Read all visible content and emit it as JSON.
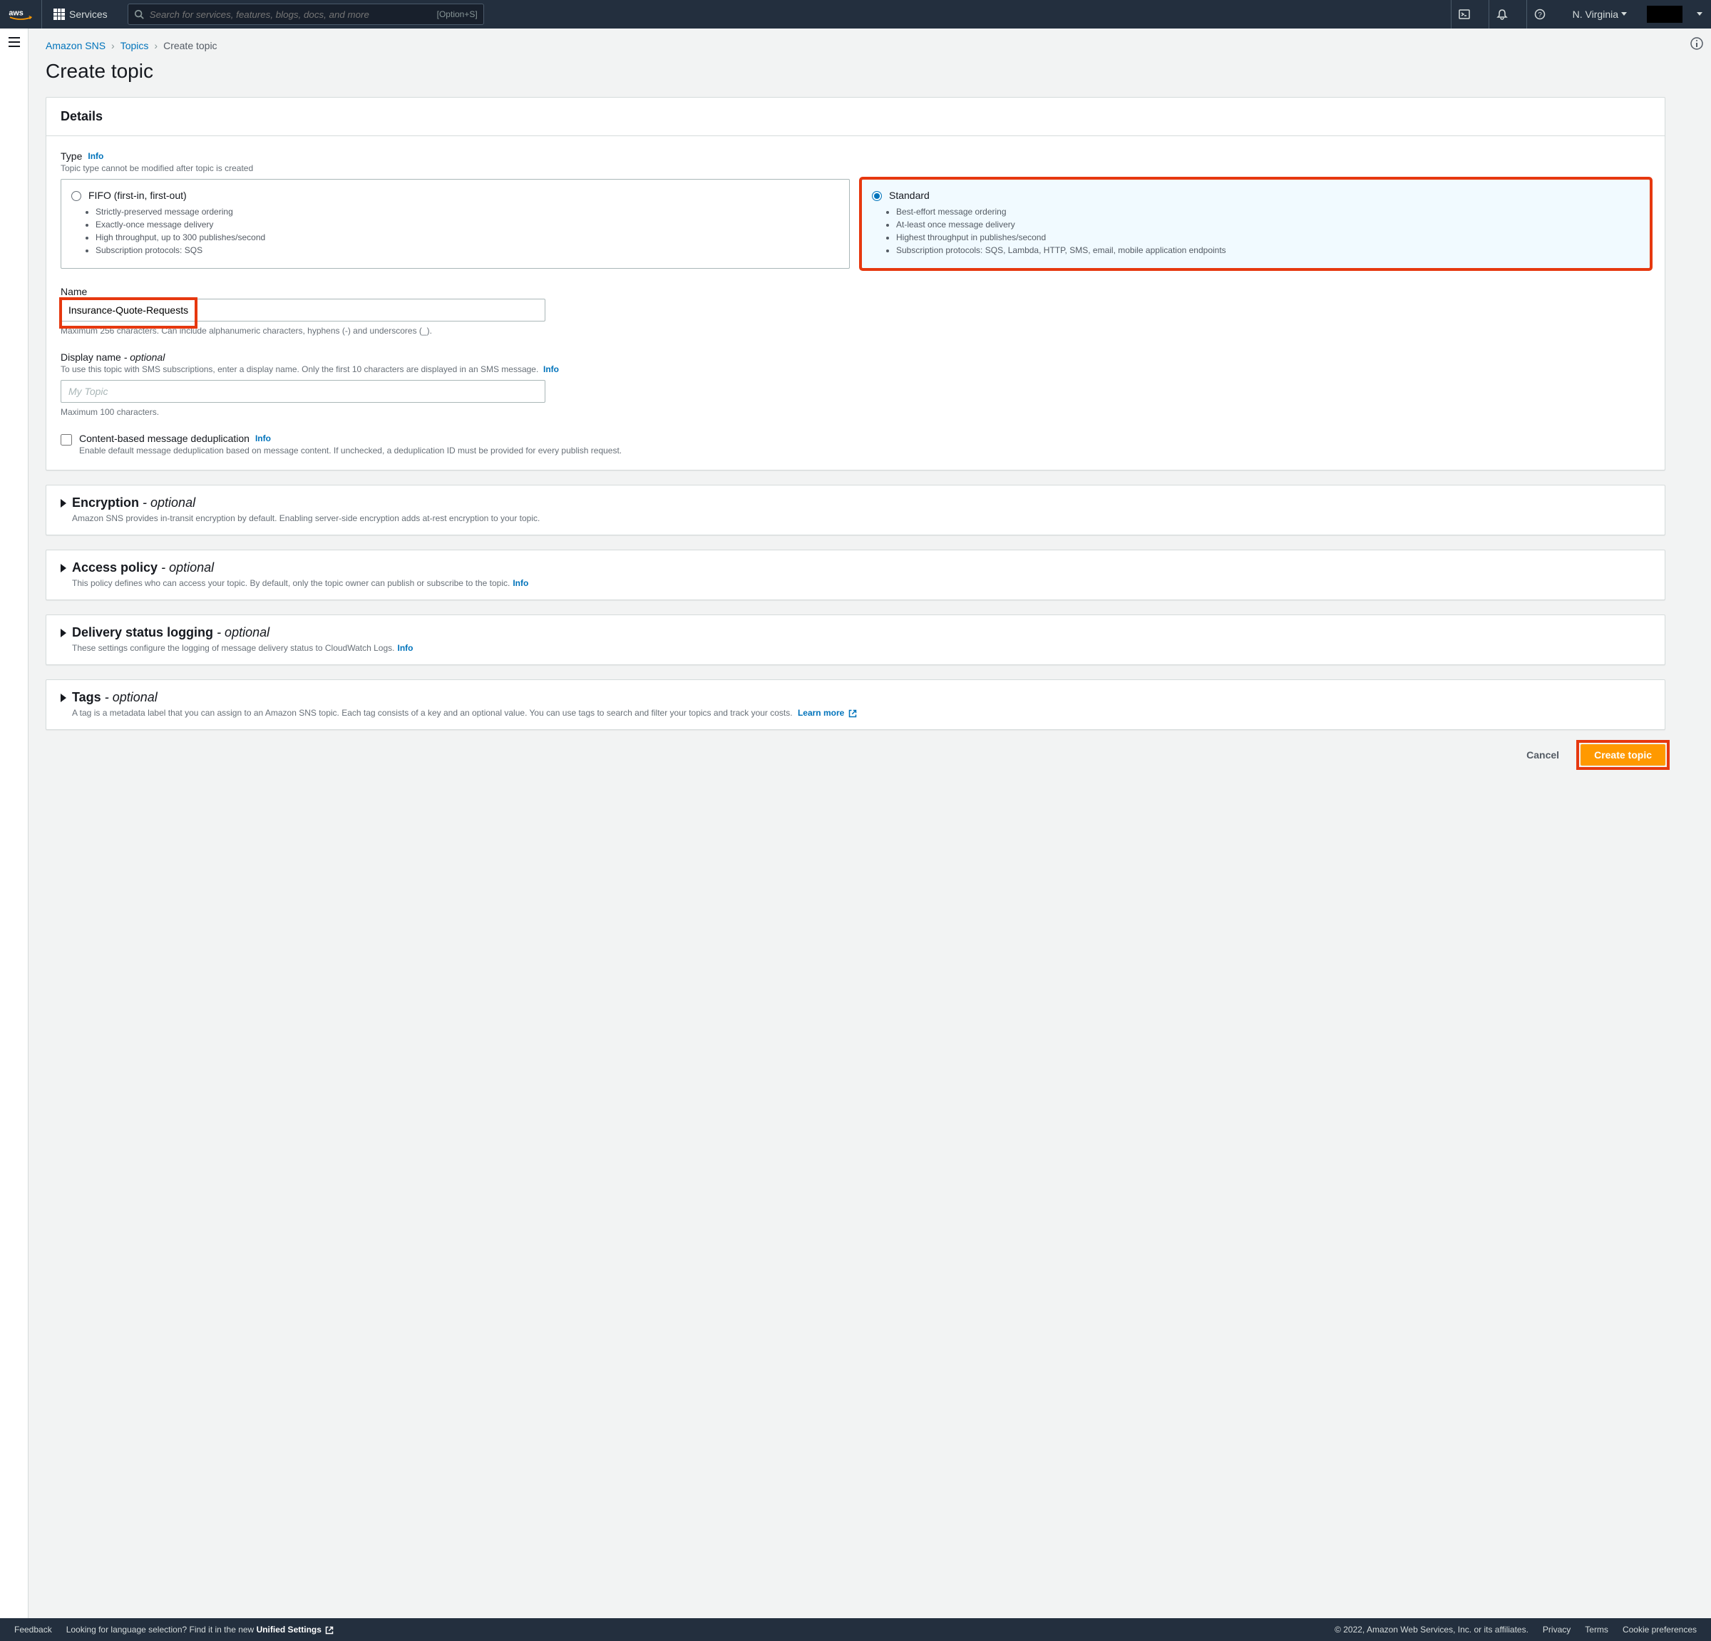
{
  "topnav": {
    "services": "Services",
    "search_placeholder": "Search for services, features, blogs, docs, and more",
    "shortcut": "[Option+S]",
    "region": "N. Virginia"
  },
  "breadcrumb": {
    "items": [
      "Amazon SNS",
      "Topics",
      "Create topic"
    ]
  },
  "page_title": "Create topic",
  "details": {
    "heading": "Details",
    "type": {
      "label": "Type",
      "info": "Info",
      "hint": "Topic type cannot be modified after topic is created",
      "fifo": {
        "title": "FIFO (first-in, first-out)",
        "bullets": [
          "Strictly-preserved message ordering",
          "Exactly-once message delivery",
          "High throughput, up to 300 publishes/second",
          "Subscription protocols: SQS"
        ]
      },
      "standard": {
        "title": "Standard",
        "bullets": [
          "Best-effort message ordering",
          "At-least once message delivery",
          "Highest throughput in publishes/second",
          "Subscription protocols: SQS, Lambda, HTTP, SMS, email, mobile application endpoints"
        ]
      }
    },
    "name": {
      "label": "Name",
      "value": "Insurance-Quote-Requests",
      "hint": "Maximum 256 characters. Can include alphanumeric characters, hyphens (-) and underscores (_)."
    },
    "display_name": {
      "label": "Display name",
      "optional": "- optional",
      "hint": "To use this topic with SMS subscriptions, enter a display name. Only the first 10 characters are displayed in an SMS message.",
      "info": "Info",
      "placeholder": "My Topic",
      "post_hint": "Maximum 100 characters."
    },
    "dedup": {
      "label": "Content-based message deduplication",
      "info": "Info",
      "desc": "Enable default message deduplication based on message content. If unchecked, a deduplication ID must be provided for every publish request."
    }
  },
  "encryption": {
    "title": "Encryption",
    "optional": "- optional",
    "desc": "Amazon SNS provides in-transit encryption by default. Enabling server-side encryption adds at-rest encryption to your topic."
  },
  "access_policy": {
    "title": "Access policy",
    "optional": "- optional",
    "desc": "This policy defines who can access your topic. By default, only the topic owner can publish or subscribe to the topic.",
    "info": "Info"
  },
  "delivery": {
    "title": "Delivery status logging",
    "optional": "- optional",
    "desc": "These settings configure the logging of message delivery status to CloudWatch Logs.",
    "info": "Info"
  },
  "tags": {
    "title": "Tags",
    "optional": "- optional",
    "desc": "A tag is a metadata label that you can assign to an Amazon SNS topic. Each tag consists of a key and an optional value. You can use tags to search and filter your topics and track your costs.",
    "learn_more": "Learn more"
  },
  "actions": {
    "cancel": "Cancel",
    "create": "Create topic"
  },
  "footer": {
    "feedback": "Feedback",
    "lang_prompt": "Looking for language selection? Find it in the new",
    "unified": "Unified Settings",
    "copyright": "© 2022, Amazon Web Services, Inc. or its affiliates.",
    "privacy": "Privacy",
    "terms": "Terms",
    "cookie": "Cookie preferences"
  }
}
